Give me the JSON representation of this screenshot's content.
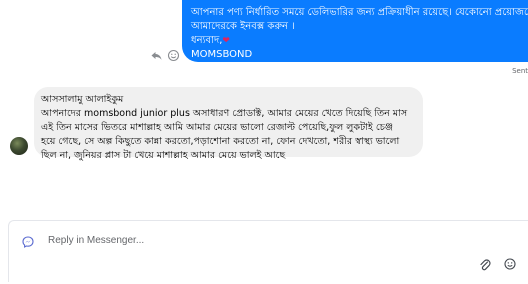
{
  "outgoing": {
    "line1": "আপনার পণ্য নির্ধারিত সময়ে ডেলিভারির জন্য প্রক্রিয়াধীন রয়েছে। যেকোনো প্রয়োজনে",
    "line2": "আমাদেরকে ইনবক্স করুন ।",
    "line3": "ধন্যবাদ,",
    "line4": "MOMSBOND",
    "heart_icon": "heart-icon"
  },
  "message_actions": {
    "reply_icon": "reply-icon",
    "react_icon": "smiley-icon"
  },
  "status": {
    "sent_label": "Sent"
  },
  "incoming": {
    "line1": "আসসালামু আলাইকুম",
    "line2": "আপনাদের momsbond junior  plus অসাধারণ প্রোডাক্ট, আমার মেয়ের খেতে দিয়েছি তিন মাস",
    "line3": "এই তিন মাসের ভিতরে মাশাল্লাহ আমি আমার মেয়ের ভালো রেজাল্ট পেয়েছি,ফুল লুকটাই চেঞ্জ",
    "line4": "হয়ে গেছে, সে অল্প কিছুতে কান্না করতো,পড়াশোনা করতো না, ফোন দেখতো, শরীর স্বাস্থ্য ভালো",
    "line5": "ছিল না, জুনিয়র প্লাস টা খেয়ে মাশাল্লাহ আমার মেয়ে ভালই আছে"
  },
  "composer": {
    "placeholder": "Reply in Messenger...",
    "icons": [
      "messenger-icon",
      "attachment-icon",
      "emoji-icon"
    ]
  },
  "colors": {
    "outgoing_bubble": "#0a7cff",
    "incoming_bubble": "#f0f0f0",
    "heart": "#e0245e"
  }
}
